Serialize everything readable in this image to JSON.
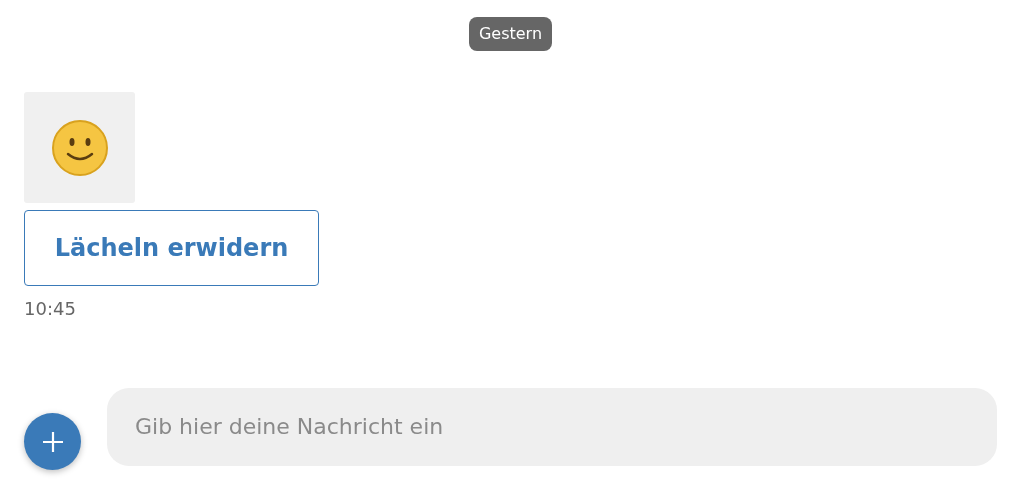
{
  "date_divider": "Gestern",
  "message": {
    "kind": "sticker",
    "action": "Lächeln erwidern",
    "time": "10:45"
  },
  "composer": {
    "placeholder": "Gib hier deine Nachricht ein"
  }
}
